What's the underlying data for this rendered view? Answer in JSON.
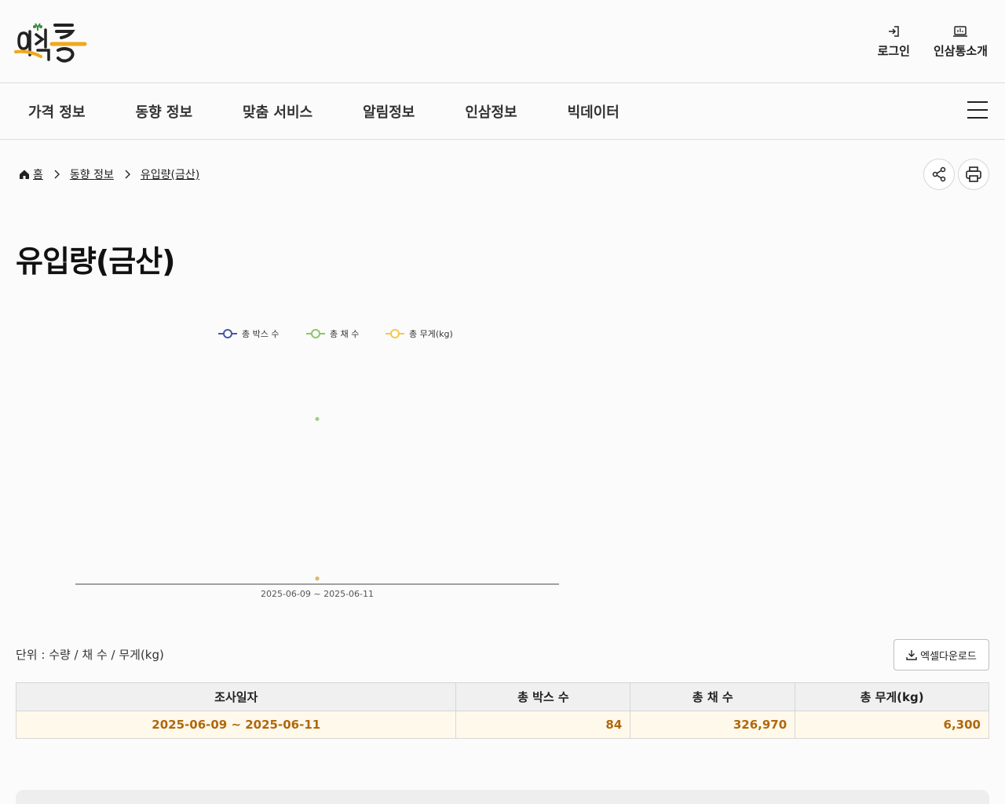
{
  "header": {
    "links": [
      {
        "label": "로그인",
        "icon": "login-icon"
      },
      {
        "label": "인삼통소개",
        "icon": "laptop-icon"
      }
    ]
  },
  "nav": {
    "items": [
      "가격 정보",
      "동향 정보",
      "맞춤 서비스",
      "알림정보",
      "인삼정보",
      "빅데이터"
    ]
  },
  "breadcrumb": {
    "home": "홈",
    "items": [
      "동향 정보",
      "유입량(금산)"
    ]
  },
  "page_title": "유입량(금산)",
  "chart_data": {
    "type": "line",
    "categories": [
      "2025-06-09 ~ 2025-06-11"
    ],
    "series": [
      {
        "name": "총 박스 수",
        "color": "#4a56a6",
        "values": [
          84
        ]
      },
      {
        "name": "총 채 수",
        "color": "#8cc56a",
        "values": [
          326970
        ]
      },
      {
        "name": "총 무게(kg)",
        "color": "#f2c94c",
        "values": [
          6300
        ]
      }
    ],
    "legend_position": "top",
    "grid": false
  },
  "unit_text": "단위 : 수량 / 채 수 / 무게(kg)",
  "download_label": "엑셀다운로드",
  "table": {
    "headers": [
      "조사일자",
      "총 박스 수",
      "총 채 수",
      "총 무게(kg)"
    ],
    "rows": [
      [
        "2025-06-09 ~ 2025-06-11",
        "84",
        "326,970",
        "6,300"
      ]
    ]
  },
  "colors": {
    "accent": "#b0680c",
    "row_highlight": "#fff9ec"
  }
}
